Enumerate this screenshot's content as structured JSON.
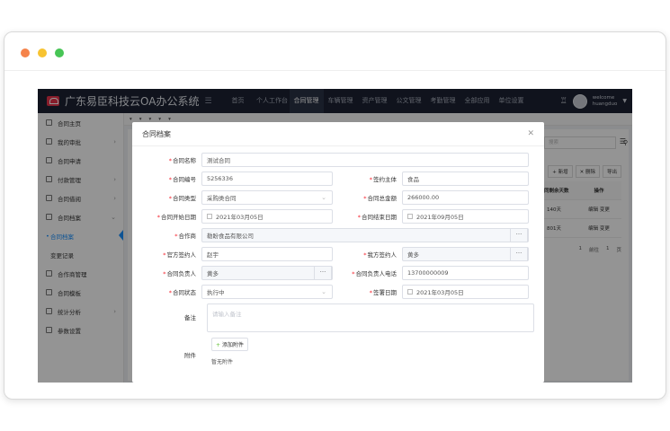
{
  "browser": {
    "dot_colors": [
      "#f5834a",
      "#f7c331",
      "#47c555"
    ]
  },
  "app": {
    "brand": "广东易臣科技云OA办公系统",
    "nav": [
      "首页",
      "个人工作台",
      "合同管理",
      "车辆管理",
      "资产管理",
      "公文管理",
      "考勤管理",
      "全部应用",
      "单位设置"
    ],
    "user": {
      "welcome": "welcome",
      "name": "huangduo"
    }
  },
  "sidebar": {
    "items": [
      {
        "label": "合同主页",
        "arrow": ""
      },
      {
        "label": "我的审批",
        "arrow": "›"
      },
      {
        "label": "合同申请",
        "arrow": ""
      },
      {
        "label": "付款管理",
        "arrow": "›"
      },
      {
        "label": "合同借阅",
        "arrow": "›"
      },
      {
        "label": "合同档案",
        "arrow": "⌄"
      },
      {
        "label": "合同档案",
        "arrow": "",
        "sub": true,
        "active": true
      },
      {
        "label": "变更记录",
        "arrow": "",
        "sub": true
      },
      {
        "label": "合作商管理",
        "arrow": ""
      },
      {
        "label": "合同模板",
        "arrow": ""
      },
      {
        "label": "统计分析",
        "arrow": "›"
      },
      {
        "label": "参数设置",
        "arrow": ""
      }
    ]
  },
  "background": {
    "search_placeholder": "搜索",
    "buttons": [
      "+ 新增",
      "✕ 删除",
      "导出"
    ],
    "table_headers": [
      "合同剩余天数",
      "操作"
    ],
    "table_rows": [
      [
        "140天",
        "编辑 变更"
      ],
      [
        "801天",
        "编辑 变更"
      ]
    ],
    "pager": [
      "1",
      "前往",
      "1",
      "页"
    ]
  },
  "modal": {
    "title": "合同档案",
    "fields": {
      "name": {
        "label": "合同名称",
        "value": "测试合同"
      },
      "number": {
        "label": "合同编号",
        "value": "5256336"
      },
      "party": {
        "label": "签约主体",
        "value": "食品"
      },
      "type": {
        "label": "合同类型",
        "value": "采购类合同"
      },
      "amount": {
        "label": "合同总金额",
        "value": "266000.00"
      },
      "start": {
        "label": "合同开始日期",
        "value": "2021年03月05日"
      },
      "end": {
        "label": "合同结束日期",
        "value": "2021年09月05日"
      },
      "partner": {
        "label": "合作商",
        "value": "勒盼食品有限公司"
      },
      "their_signer": {
        "label": "官方签约人",
        "value": "赵宇"
      },
      "our_signer": {
        "label": "我方签约人",
        "value": "黄多"
      },
      "owner": {
        "label": "合同负责人",
        "value": "黄多"
      },
      "owner_phone": {
        "label": "合同负责人电话",
        "value": "13700000009"
      },
      "status": {
        "label": "合同状态",
        "value": "执行中"
      },
      "sign_date": {
        "label": "签署日期",
        "value": "2021年03月05日"
      },
      "remark": {
        "label": "备注",
        "placeholder": "请输入备注"
      },
      "attachment": {
        "label": "附件",
        "add_button": "添加附件",
        "empty": "暂无附件"
      }
    }
  }
}
